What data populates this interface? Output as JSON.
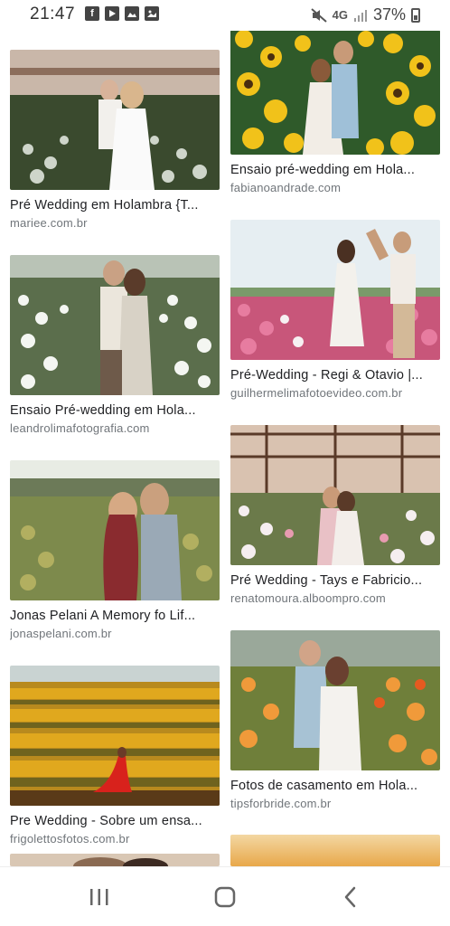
{
  "status_bar": {
    "time": "21:47",
    "battery": "37%",
    "network": "4G",
    "notification_icons": [
      "facebook-icon",
      "youtube-icon",
      "gallery-icon",
      "image-icon"
    ]
  },
  "colors": {
    "title": "#202124",
    "source": "#70757a",
    "background": "#ffffff"
  },
  "results": [
    {
      "title": "Pré Wedding em Holambra {T...",
      "source": "mariee.com.br",
      "thumb": "greenhouse-couple"
    },
    {
      "title": "Ensaio pré-wedding em Hola...",
      "source": "fabianoandrade.com",
      "thumb": "sunflower-couple"
    },
    {
      "title": "Ensaio Pré-wedding em Hola...",
      "source": "leandrolimafotografia.com",
      "thumb": "white-flowers-couple"
    },
    {
      "title": "Pré-Wedding - Regi & Otavio |...",
      "source": "guilhermelimafotoevideo.com.br",
      "thumb": "pink-field-couple"
    },
    {
      "title": "Jonas Pelani A Memory fo Lif...",
      "source": "jonaspelani.com.br",
      "thumb": "field-couple-closeup"
    },
    {
      "title": "Pré Wedding - Tays e Fabricio...",
      "source": "renatomoura.alboompro.com",
      "thumb": "greenhouse-kiss"
    },
    {
      "title": "Pre Wedding - Sobre um ensa...",
      "source": "frigolettosfotos.com.br",
      "thumb": "sunflower-field-red-dress"
    },
    {
      "title": "Fotos de casamento em Hola...",
      "source": "tipsforbride.com.br",
      "thumb": "orange-flowers-couple"
    }
  ],
  "nav": {
    "recents": "recents-icon",
    "home": "home-icon",
    "back": "back-icon"
  }
}
